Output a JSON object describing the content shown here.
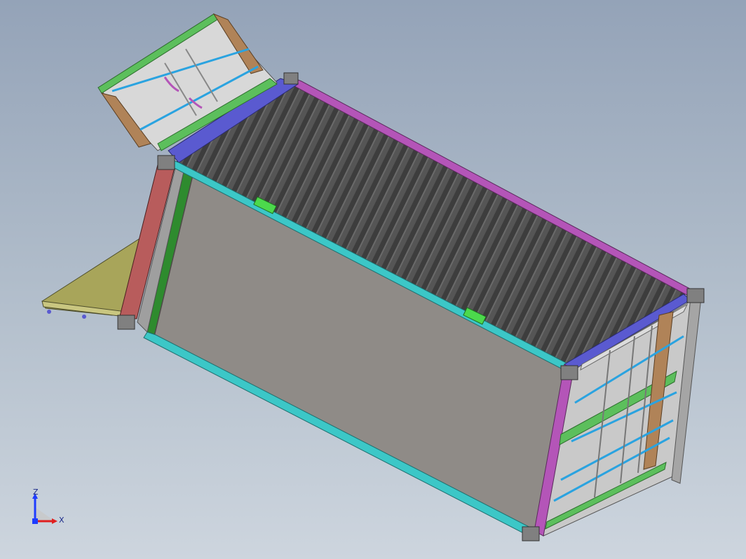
{
  "viewport": {
    "background_top": "#94a3b8",
    "background_bottom": "#cdd5de"
  },
  "model": {
    "name_icon": "shipping-container-3d-model",
    "colors": {
      "roof_corrugation": "#4a4a4a",
      "side_panel": "#8f8b87",
      "bottom_rail": "#3cc7c7",
      "top_rail_purple": "#b455b8",
      "end_frame_red": "#b85c5c",
      "end_frame_green": "#2e8b2e",
      "header_blue": "#5a5ad0",
      "door_panel": "#c9c9c9",
      "door_frame_brown": "#b08358",
      "door_frame_green": "#5cbf5c",
      "floor_panel": "#a8a55a",
      "corner_casting": "#808080",
      "locking_bar": "#2aa3e0"
    }
  },
  "triad": {
    "z_label": "Z",
    "x_label": "X",
    "z_color": "#1f3cff",
    "x_color": "#e02020"
  }
}
